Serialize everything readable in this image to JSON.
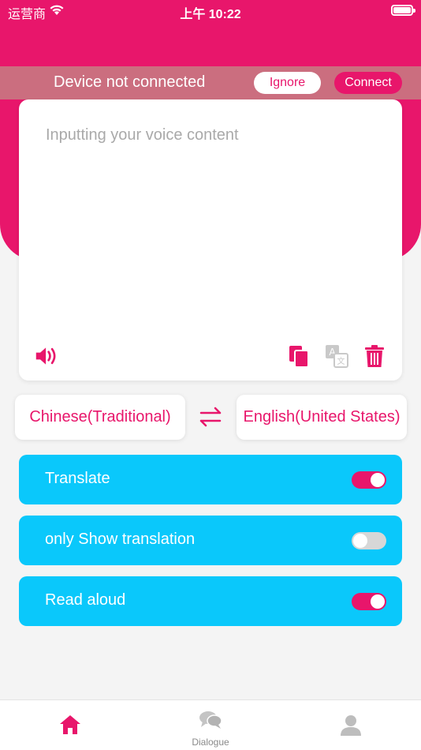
{
  "status_bar": {
    "carrier": "运营商",
    "time": "上午 10:22"
  },
  "banner": {
    "message": "Device not connected",
    "ignore_label": "Ignore",
    "connect_label": "Connect"
  },
  "input": {
    "placeholder": "Inputting your voice content",
    "value": ""
  },
  "card_icons": [
    "speaker-icon",
    "copy-icon",
    "translate-icon",
    "trash-icon"
  ],
  "languages": {
    "source": "Chinese(Traditional)",
    "target": "English(United States)"
  },
  "toggles": [
    {
      "label": "Translate",
      "on": true
    },
    {
      "label": "only Show translation",
      "on": false
    },
    {
      "label": "Read aloud",
      "on": true
    }
  ],
  "nav": {
    "items": [
      {
        "icon": "home-icon",
        "label": "",
        "active": true
      },
      {
        "icon": "chat-icon",
        "label": "Dialogue",
        "active": false
      },
      {
        "icon": "person-icon",
        "label": "",
        "active": false
      }
    ]
  },
  "colors": {
    "accent": "#e8166b",
    "row_bg": "#0ac8fb",
    "background": "#f4f4f4"
  }
}
